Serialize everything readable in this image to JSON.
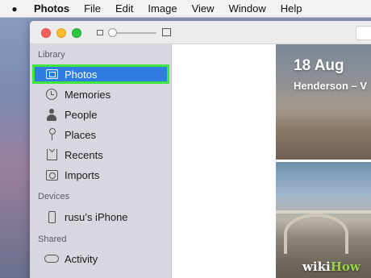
{
  "menubar": {
    "apple_icon": "apple-logo-icon",
    "app_name": "Photos",
    "items": [
      "File",
      "Edit",
      "Image",
      "View",
      "Window",
      "Help"
    ]
  },
  "window": {
    "zoom_level": 0.0
  },
  "sidebar": {
    "library_header": "Library",
    "library_items": [
      {
        "label": "Photos",
        "icon": "photos-icon",
        "selected": true
      },
      {
        "label": "Memories",
        "icon": "memories-icon"
      },
      {
        "label": "People",
        "icon": "person-icon"
      },
      {
        "label": "Places",
        "icon": "pin-icon"
      },
      {
        "label": "Recents",
        "icon": "recents-icon"
      },
      {
        "label": "Imports",
        "icon": "imports-icon"
      }
    ],
    "devices_header": "Devices",
    "device_item": {
      "label": "rusu’s iPhone",
      "icon": "iphone-icon"
    },
    "shared_header": "Shared",
    "shared_item": {
      "label": "Activity",
      "icon": "cloud-icon"
    }
  },
  "gallery": {
    "date": "18 Aug",
    "location": "Henderson – V"
  },
  "watermark": {
    "prefix": "wiki",
    "suffix": "How"
  },
  "colors": {
    "selection_blue": "#2f7de1",
    "highlight_green": "#3ee63e",
    "sidebar_bg": "#d8d6df"
  }
}
